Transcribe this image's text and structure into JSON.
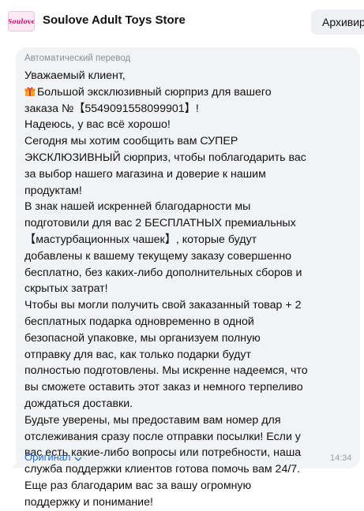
{
  "header": {
    "avatar_text": "Soulove",
    "store_name": "Soulove Adult Toys Store",
    "archive_label": "Архивир"
  },
  "message": {
    "translation_note": "Автоматический перевод",
    "lines": [
      "Уважаемый клиент,",
      "Большой эксклюзивный сюрприз для вашего",
      "заказа №【5549091558099901】!",
      "Надеюсь, у вас всё хорошо!",
      "Сегодня мы хотим сообщить вам СУПЕР",
      "ЭКСКЛЮЗИВНЫЙ сюрприз, чтобы поблагодарить вас",
      "за выбор нашего магазина и доверие к нашим",
      "продуктам!",
      "В знак нашей искренней благодарности мы",
      "подготовили для вас 2 БЕСПЛАТНЫХ премиальных",
      "【мастурбационных чашек】, которые будут",
      "добавлены к вашему текущему заказу совершенно",
      "бесплатно, без каких-либо дополнительных сборов и",
      "скрытых затрат!",
      "Чтобы вы могли получить свой заказанный товар + 2",
      "бесплатных подарка одновременно в одной",
      "безопасной упаковке, мы организуем полную",
      "отправку для вас, как только подарки будут",
      "полностью подготовлены. Мы искренне надеемся, что",
      "вы сможете оставить этот заказ и немного терпеливо",
      "дождаться доставки.",
      "Будьте уверены, мы предоставим вам номер для",
      "отслеживания сразу после отправки посылки! Если у",
      "вас есть какие-либо вопросы или потребности, наша",
      "служба поддержки клиентов готова помочь вам 24/7.",
      "Еще раз благодарим вас за вашу огромную",
      "поддержку и понимание!"
    ],
    "original_label": "Оригинал",
    "time": "14:34"
  },
  "colors": {
    "bubble": "#f2f3f5",
    "link": "#2a6fd6",
    "muted": "#8a8f96"
  }
}
